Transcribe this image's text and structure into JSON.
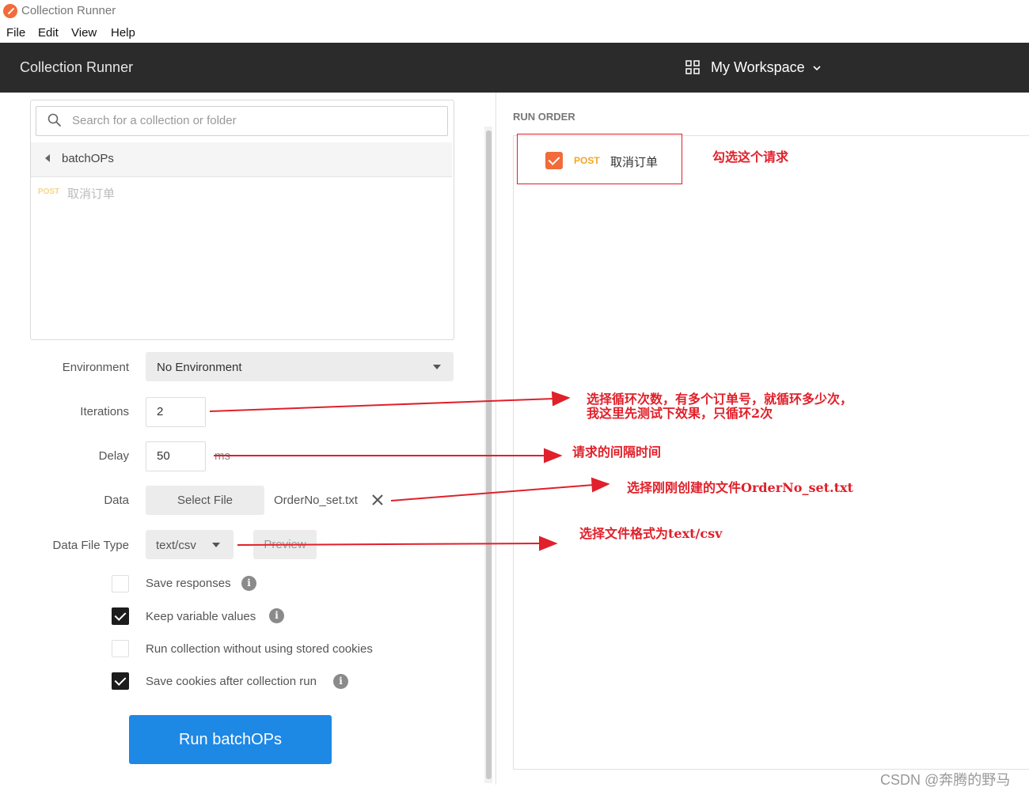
{
  "window": {
    "title": "Collection Runner"
  },
  "menu": [
    "File",
    "Edit",
    "View",
    "Help"
  ],
  "header": {
    "title": "Collection Runner",
    "workspace": "My Workspace"
  },
  "collection_panel": {
    "search_placeholder": "Search for a collection or folder",
    "folder": "batchOPs",
    "request": {
      "method": "POST",
      "name": "取消订单"
    }
  },
  "form": {
    "environment": {
      "label": "Environment",
      "value": "No Environment"
    },
    "iterations": {
      "label": "Iterations",
      "value": "2"
    },
    "delay": {
      "label": "Delay",
      "value": "50",
      "unit": "ms"
    },
    "data": {
      "label": "Data",
      "button": "Select File",
      "file": "OrderNo_set.txt"
    },
    "data_file_type": {
      "label": "Data File Type",
      "value": "text/csv",
      "preview": "Preview"
    },
    "options": [
      {
        "label": "Save responses",
        "checked": false,
        "info": true
      },
      {
        "label": "Keep variable values",
        "checked": true,
        "info": true
      },
      {
        "label": "Run collection without using stored cookies",
        "checked": false,
        "info": false
      },
      {
        "label": "Save cookies after collection run",
        "checked": true,
        "info": true
      }
    ],
    "run_button": "Run batchOPs"
  },
  "run_order": {
    "title": "RUN ORDER",
    "items": [
      {
        "method": "POST",
        "name": "取消订单",
        "checked": true
      }
    ]
  },
  "annotations": {
    "a1": "勾选这个请求",
    "a2_line1": "选择循环次数，有多个订单号，就循环多少次，",
    "a2_line2": "我这里先测试下效果，只循环2次",
    "a3": "请求的间隔时间",
    "a4": "选择刚刚创建的文件OrderNo_set.txt",
    "a5": "选择文件格式为text/csv"
  },
  "watermark": "CSDN @奔腾的野马",
  "colors": {
    "header_bg": "#2b2b2b",
    "accent_orange": "#f26b3a",
    "run_button": "#1e88e5",
    "annotation_red": "#e0202a"
  }
}
